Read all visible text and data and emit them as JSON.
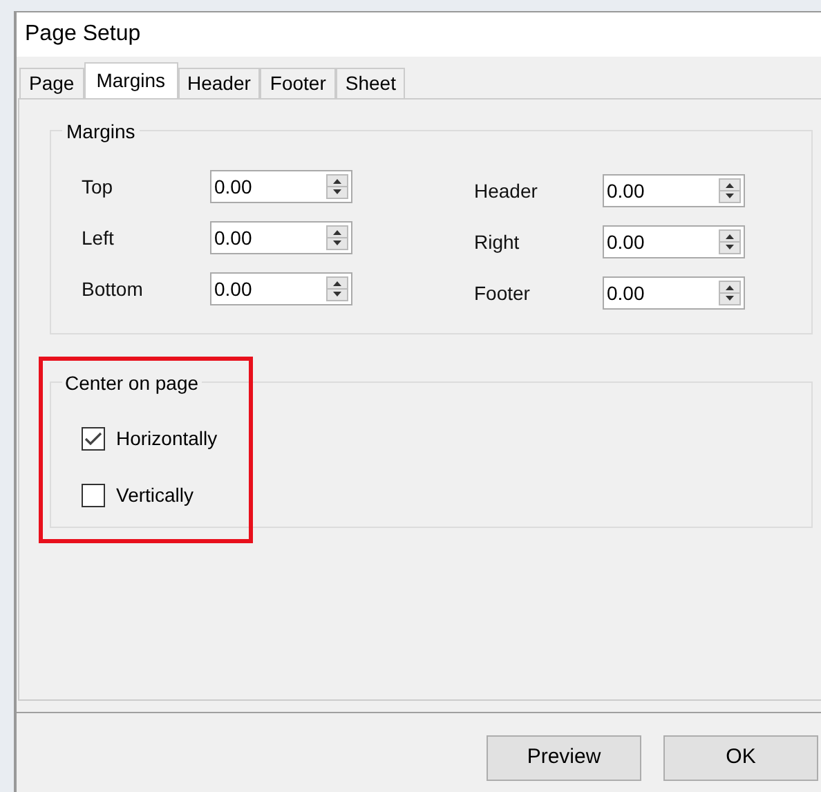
{
  "window": {
    "title": "Page Setup"
  },
  "tabs": [
    {
      "label": "Page",
      "selected": false
    },
    {
      "label": "Margins",
      "selected": true
    },
    {
      "label": "Header",
      "selected": false
    },
    {
      "label": "Footer",
      "selected": false
    },
    {
      "label": "Sheet",
      "selected": false
    }
  ],
  "margins_group": {
    "title": "Margins",
    "left_fields": [
      {
        "label": "Top",
        "value": "0.00"
      },
      {
        "label": "Left",
        "value": "0.00"
      },
      {
        "label": "Bottom",
        "value": "0.00"
      }
    ],
    "right_fields": [
      {
        "label": "Header",
        "value": "0.00"
      },
      {
        "label": "Right",
        "value": "0.00"
      },
      {
        "label": "Footer",
        "value": "0.00"
      }
    ]
  },
  "center_group": {
    "title": "Center on page",
    "highlighted": true,
    "options": [
      {
        "label": "Horizontally",
        "checked": true
      },
      {
        "label": "Vertically",
        "checked": false
      }
    ]
  },
  "buttons": [
    "Preview",
    "OK"
  ]
}
